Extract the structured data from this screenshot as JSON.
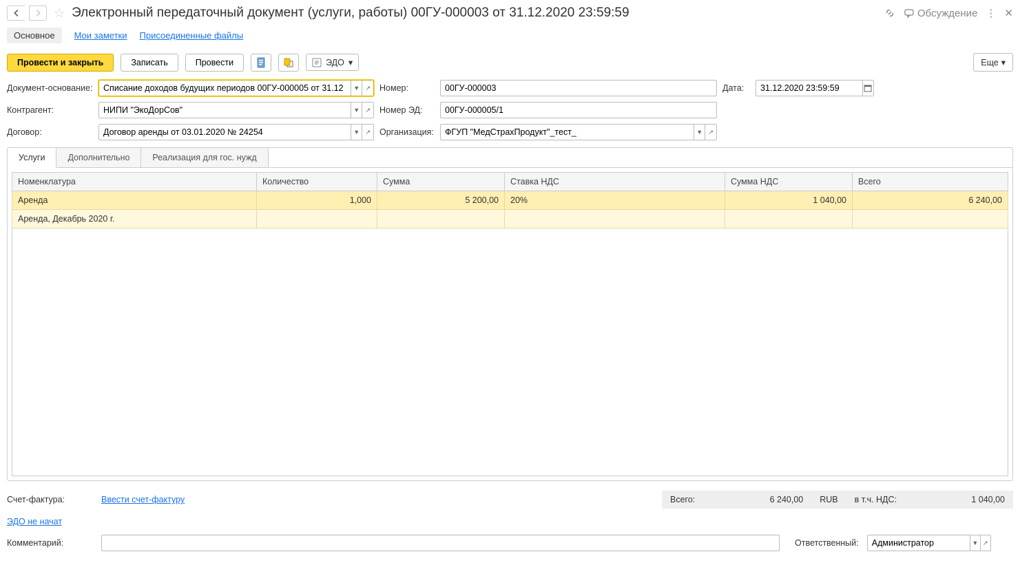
{
  "header": {
    "title": "Электронный передаточный документ (услуги, работы) 00ГУ-000003 от 31.12.2020 23:59:59",
    "discussion": "Обсуждение"
  },
  "viewTabs": {
    "main": "Основное",
    "notes": "Мои заметки",
    "files": "Присоединенные файлы"
  },
  "toolbar": {
    "postClose": "Провести и закрыть",
    "save": "Записать",
    "post": "Провести",
    "edo": "ЭДО",
    "more": "Еще"
  },
  "form": {
    "basisLabel": "Документ-основание:",
    "basisValue": "Списание доходов будущих периодов 00ГУ-000005 от 31.12",
    "numberLabel": "Номер:",
    "numberValue": "00ГУ-000003",
    "dateLabel": "Дата:",
    "dateValue": "31.12.2020 23:59:59",
    "counterpartyLabel": "Контрагент:",
    "counterpartyValue": "НИПИ \"ЭкоДорСов\"",
    "edNumberLabel": "Номер ЭД:",
    "edNumberValue": "00ГУ-000005/1",
    "contractLabel": "Договор:",
    "contractValue": "Договор аренды от 03.01.2020 № 24254",
    "orgLabel": "Организация:",
    "orgValue": "ФГУП \"МедСтрахПродукт\"_тест_"
  },
  "docTabs": {
    "services": "Услуги",
    "additional": "Дополнительно",
    "gov": "Реализация для гос. нужд"
  },
  "table": {
    "headers": {
      "nomenclature": "Номенклатура",
      "qty": "Количество",
      "sum": "Сумма",
      "vatRate": "Ставка НДС",
      "vatSum": "Сумма НДС",
      "total": "Всего"
    },
    "row1": {
      "nomenclature": "Аренда",
      "qty": "1,000",
      "sum": "5 200,00",
      "vatRate": "20%",
      "vatSum": "1 040,00",
      "total": "6 240,00"
    },
    "row2": {
      "nomenclature": "Аренда, Декабрь 2020 г."
    }
  },
  "footer": {
    "invoiceLabel": "Счет-фактура:",
    "invoiceLink": "Ввести счет-фактуру",
    "totalsLabel": "Всего:",
    "totalsValue": "6 240,00",
    "currency": "RUB",
    "vatInclLabel": "в т.ч. НДС:",
    "vatInclValue": "1 040,00",
    "edoStatus": "ЭДО не начат",
    "commentLabel": "Комментарий:",
    "responsibleLabel": "Ответственный:",
    "responsibleValue": "Администратор"
  }
}
